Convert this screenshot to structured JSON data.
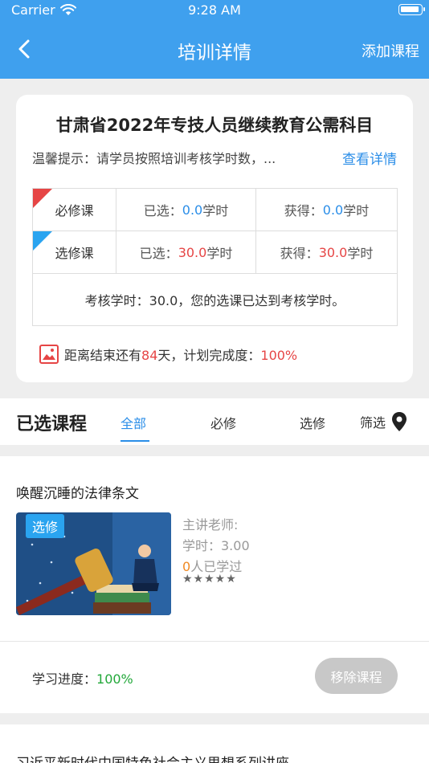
{
  "status_bar": {
    "carrier": "Carrier",
    "time": "9:28 AM"
  },
  "nav": {
    "title": "培训详情",
    "right_action": "添加课程"
  },
  "summary": {
    "title": "甘肃省2022年专技人员继续教育公需科目",
    "tip": "温馨提示：请学员按照培训考核学时数，...",
    "tip_link": "查看详情",
    "required": {
      "label": "必修课",
      "selected_prefix": "已选：",
      "selected_value": "0.0",
      "selected_unit": "学时",
      "earned_prefix": "获得：",
      "earned_value": "0.0",
      "earned_unit": "学时"
    },
    "elective": {
      "label": "选修课",
      "selected_prefix": "已选：",
      "selected_value": "30.0",
      "selected_unit": "学时",
      "earned_prefix": "获得：",
      "earned_value": "30.0",
      "earned_unit": "学时"
    },
    "assessment": "考核学时：30.0，您的选课已达到考核学时。",
    "deadline_prefix": "距离结束还有",
    "deadline_days": "84",
    "deadline_suffix": "天，计划完成度：",
    "completion": "100%"
  },
  "section": {
    "title": "已选课程",
    "tabs": [
      "全部",
      "必修",
      "选修"
    ],
    "active_tab": "全部",
    "filter": "筛选"
  },
  "courses": [
    {
      "title": "唤醒沉睡的法律条文",
      "badge": "选修",
      "teacher": "主讲老师:",
      "hours": "学时：3.00",
      "learners_count": "0",
      "learners_suffix": "人已学过",
      "stars": "★★★★★",
      "progress_label": "学习进度：",
      "progress_value": "100%",
      "remove_label": "移除课程"
    },
    {
      "title": "习近平新时代中国特色社会主义思想系列讲座"
    }
  ],
  "colors": {
    "header": "#3fa0ee",
    "accent_blue": "#2b8ee8",
    "accent_red": "#e64545",
    "progress_green": "#22a83a"
  }
}
